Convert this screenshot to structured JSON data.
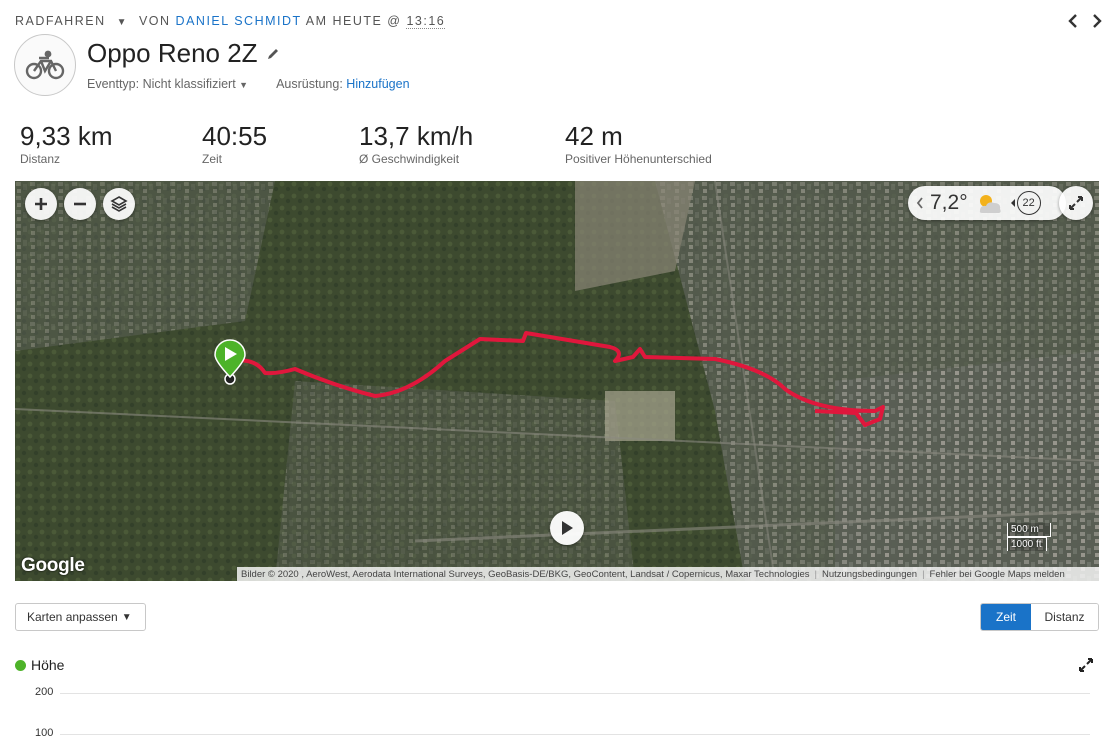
{
  "header": {
    "activity_type": "RADFAHREN",
    "by_prefix": "VON",
    "author": "DANIEL SCHMIDT",
    "date_text": "AM HEUTE @",
    "time": "13:16",
    "prev_icon": "chevron-left-icon",
    "next_icon": "chevron-right-icon"
  },
  "activity": {
    "title": "Oppo Reno 2Z",
    "icon": "bicycle-icon",
    "event_type_label": "Eventtyp:",
    "event_type_value": "Nicht klassifiziert",
    "gear_label": "Ausrüstung:",
    "gear_link": "Hinzufügen"
  },
  "stats": [
    {
      "value": "9,33 km",
      "label": "Distanz"
    },
    {
      "value": "40:55",
      "label": "Zeit"
    },
    {
      "value": "13,7 km/h",
      "label": "Ø Geschwindigkeit"
    },
    {
      "value": "42 m",
      "label": "Positiver Höhenunterschied"
    }
  ],
  "map": {
    "weather_temp": "7,2°",
    "wind_value": "22",
    "google_logo": "Google",
    "scale_metric": "500 m",
    "scale_imperial": "1000 ft",
    "attribution": "Bilder © 2020 , AeroWest, Aerodata International Surveys, GeoBasis-DE/BKG, GeoContent, Landsat / Copernicus, Maxar Technologies",
    "terms": "Nutzungsbedingungen",
    "report": "Fehler bei Google Maps melden",
    "route_color": "#e0173c",
    "start_marker_color": "#4db329"
  },
  "controls": {
    "customize_maps": "Karten anpassen",
    "toggle_time": "Zeit",
    "toggle_distance": "Distanz"
  },
  "chart": {
    "legend": "Höhe",
    "legend_color": "#4db329",
    "y_ticks": [
      "200",
      "100"
    ]
  }
}
